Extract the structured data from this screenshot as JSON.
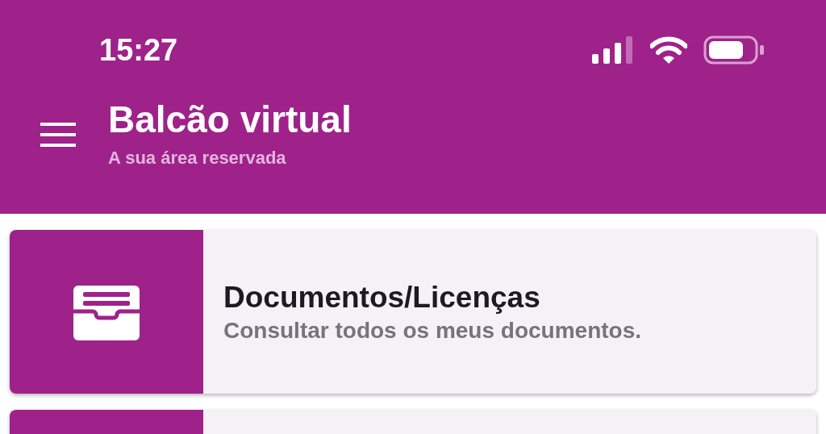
{
  "status_bar": {
    "time": "15:27"
  },
  "header": {
    "title": "Balcão virtual",
    "subtitle": "A sua área reservada"
  },
  "cards": [
    {
      "kind": "full",
      "title": "Documentos/Licenças",
      "subtitle": "Consultar todos os meus documentos."
    },
    {
      "kind": "partial"
    }
  ]
}
